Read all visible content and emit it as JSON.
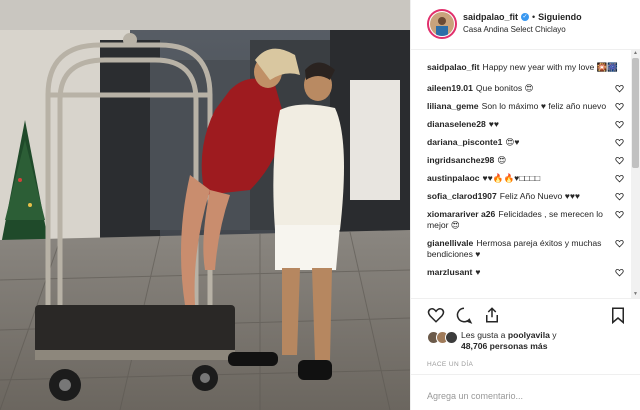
{
  "post": {
    "username": "saidpalao_fit",
    "follow_label": "Siguiendo",
    "separator": "•",
    "location": "Casa Andina Select Chiclayo",
    "time_ago": "HACE UN DÍA",
    "likes_prefix": "Les gusta a ",
    "liker": "poolyavila",
    "likes_and": " y",
    "likes_count": "48,706 personas más",
    "comment_placeholder": "Agrega un comentario..."
  },
  "caption": {
    "user": "saidpalao_fit",
    "text": "Happy new year with my love 🎇🎆"
  },
  "comments": [
    {
      "user": "aileen19.01",
      "text": "Que bonitos 😍"
    },
    {
      "user": "liliana_geme",
      "text": "Son lo máximo ♥ feliz año nuevo"
    },
    {
      "user": "dianaselene28",
      "text": "♥♥"
    },
    {
      "user": "dariana_pisconte1",
      "text": "😍♥"
    },
    {
      "user": "ingridsanchez98",
      "text": "😍"
    },
    {
      "user": "austinpalaoc",
      "text": "♥♥🔥🔥♥□□□□"
    },
    {
      "user": "sofia_clarod1907",
      "text": "Feliz Año Nuevo ♥♥♥"
    },
    {
      "user": "xiomarariver a26",
      "text": "Felicidades , se merecen lo mejor 😍"
    },
    {
      "user": "gianellivale",
      "text": "Hermosa pareja éxitos y muchas bendiciones ♥"
    },
    {
      "user": "marzlusant",
      "text": "♥"
    }
  ],
  "icons": {
    "like": "heart-outline-icon",
    "comment": "speech-bubble-icon",
    "share": "share-icon",
    "save": "bookmark-icon",
    "verified": "verified-badge-icon",
    "comment_like": "small-heart-icon"
  },
  "colors": {
    "accent": "#3897f0",
    "story_ring": "#e1306c",
    "border": "#efefef",
    "muted": "#999999"
  }
}
